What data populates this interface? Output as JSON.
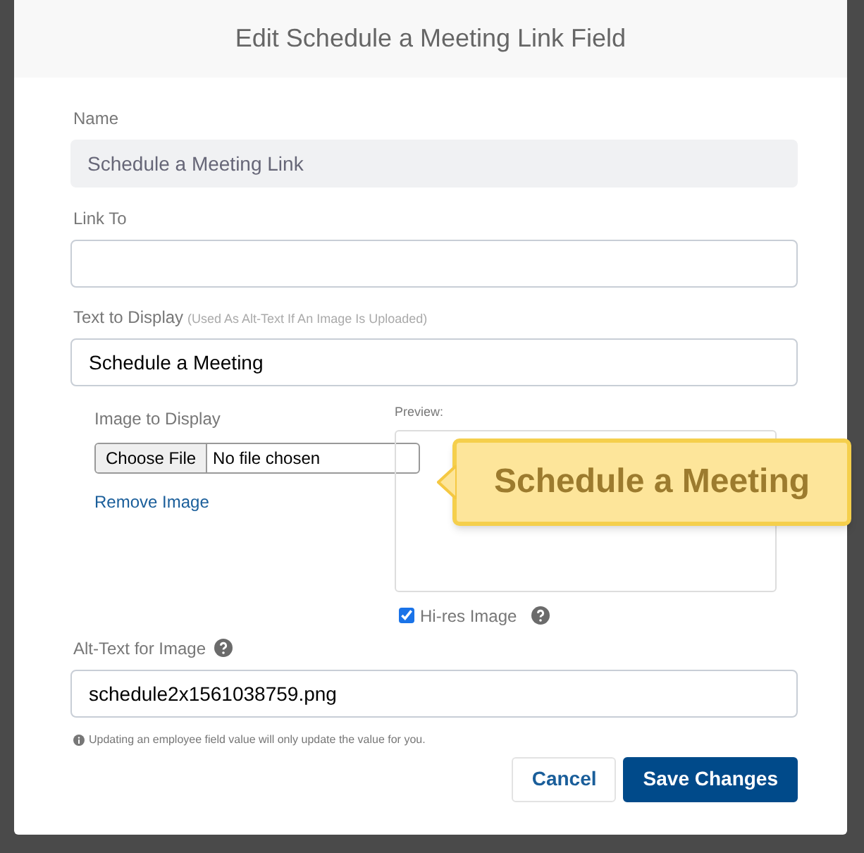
{
  "dialog": {
    "title": "Edit Schedule a Meeting Link Field"
  },
  "name_field": {
    "label": "Name",
    "value": "Schedule a Meeting Link",
    "disabled": true
  },
  "link_field": {
    "label": "Link To"
  },
  "text_field": {
    "label": "Text to Display",
    "hint": "(Used As Alt-Text If An Image Is Uploaded)",
    "value": "Schedule a Meeting"
  },
  "image": {
    "label": "Image to Display",
    "choose_button": "Choose File",
    "file_status": "No file chosen",
    "remove_link": "Remove Image"
  },
  "preview": {
    "label": "Preview:",
    "image_text": "Schedule a Meeting"
  },
  "hires": {
    "label": "Hi-res Image",
    "checked": true
  },
  "alt_field": {
    "label": "Alt-Text for Image",
    "value": "schedule2x1561038759.png"
  },
  "note": "Updating an employee field value will only update the value for you.",
  "buttons": [
    {
      "label": "Cancel",
      "kind": "secondary"
    },
    {
      "label": "Save Changes",
      "kind": "primary"
    }
  ]
}
